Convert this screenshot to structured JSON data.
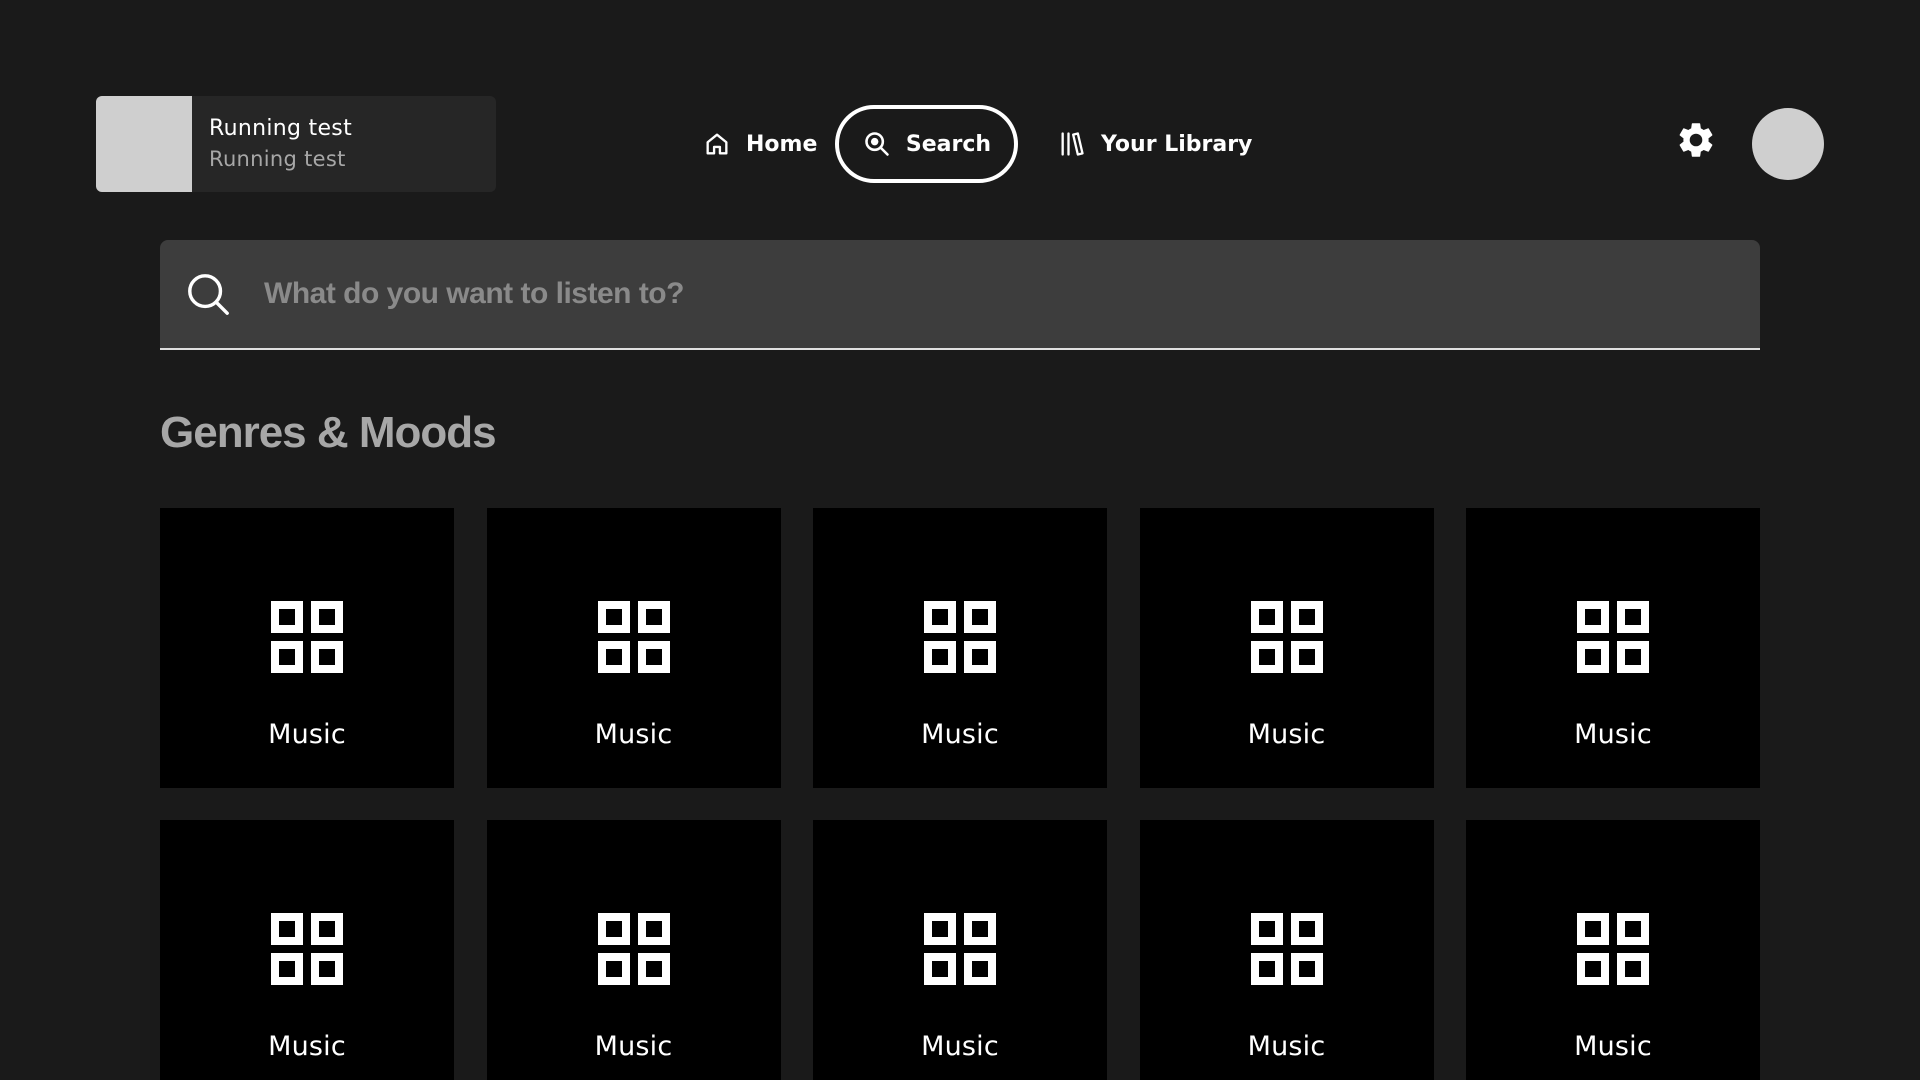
{
  "now_playing": {
    "title": "Running test",
    "subtitle": "Running test",
    "artwork_icon": "album-art-placeholder"
  },
  "nav": {
    "items": [
      {
        "label": "Home",
        "icon": "home-icon",
        "active": false
      },
      {
        "label": "Search",
        "icon": "search-icon",
        "active": true
      },
      {
        "label": "Your Library",
        "icon": "library-icon",
        "active": false
      }
    ]
  },
  "header": {
    "settings_icon": "gear-icon",
    "avatar_icon": "avatar"
  },
  "search": {
    "placeholder": "What do you want to listen to?",
    "value": ""
  },
  "genres": {
    "title": "Genres & Moods",
    "items": [
      {
        "label": "Music",
        "icon": "category-grid-icon"
      },
      {
        "label": "Music",
        "icon": "category-grid-icon"
      },
      {
        "label": "Music",
        "icon": "category-grid-icon"
      },
      {
        "label": "Music",
        "icon": "category-grid-icon"
      },
      {
        "label": "Music",
        "icon": "category-grid-icon"
      },
      {
        "label": "Music",
        "icon": "category-grid-icon"
      },
      {
        "label": "Music",
        "icon": "category-grid-icon"
      },
      {
        "label": "Music",
        "icon": "category-grid-icon"
      },
      {
        "label": "Music",
        "icon": "category-grid-icon"
      },
      {
        "label": "Music",
        "icon": "category-grid-icon"
      }
    ]
  },
  "colors": {
    "background": "#1a1a1a",
    "surface": "#262626",
    "search_field": "#3d3d3d",
    "tile": "#000000",
    "text_primary": "#ffffff",
    "text_secondary": "#a7a7a7"
  }
}
